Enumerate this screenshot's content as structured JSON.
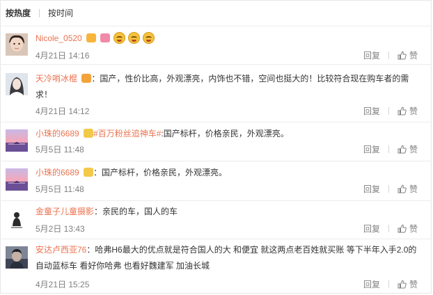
{
  "sort": {
    "hot_label": "按热度",
    "time_label": "按时间"
  },
  "labels": {
    "reply": "回复",
    "like": "赞"
  },
  "colors": {
    "username": "#eb7350",
    "meta": "#808080",
    "text": "#333333"
  },
  "comments": [
    {
      "user": "Nicole_0520",
      "badges": [
        "gift-badge-icon",
        "heart-badge-icon"
      ],
      "text": "",
      "emoji": [
        "laughing-face-icon",
        "laughing-face-icon",
        "laughing-face-icon"
      ],
      "time": "4月21日 14:16"
    },
    {
      "user": "天冷哨冰棍",
      "badges": [
        "vip-badge-icon"
      ],
      "text": "：国产，性价比高，外观漂亮，内饰也不错，空间也挺大的！比较符合现在购车者的需求！",
      "time": "4月21日 14:12"
    },
    {
      "user": "小珠的6689",
      "badges": [
        "cat-badge-icon"
      ],
      "topic": "#百万粉丝追神车#",
      "text": ":国产标杆，价格亲民，外观漂亮。",
      "time": "5月5日 11:48"
    },
    {
      "user": "小珠的6689",
      "badges": [
        "cat-badge-icon"
      ],
      "text": "：国产标杆，价格亲民，外观漂亮。",
      "time": "5月5日 11:48"
    },
    {
      "user": "金童子儿童摄影",
      "badges": [],
      "text": "：亲民的车，国人的车",
      "time": "5月2日 13:43"
    },
    {
      "user": "安达卢西亚76",
      "badges": [],
      "text": "：哈弗H6最大的优点就是符合国人的大 和便宜 就这两点老百姓就买账 等下半年入手2.0的自动蓝标车 看好你哈弗 也看好魏建军 加油长城",
      "time": "4月21日 15:25"
    }
  ]
}
